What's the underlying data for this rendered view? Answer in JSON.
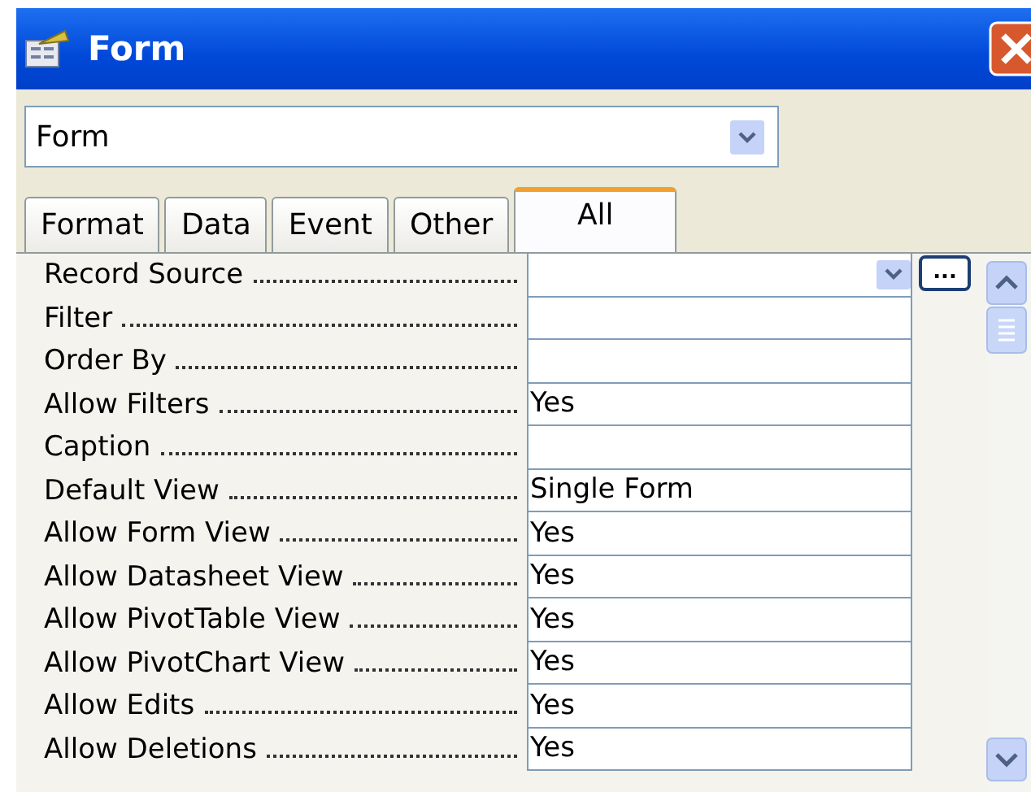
{
  "window": {
    "title": "Form"
  },
  "object_selector": {
    "value": "Form"
  },
  "tabs": [
    {
      "label": "Format",
      "selected": false
    },
    {
      "label": "Data",
      "selected": false
    },
    {
      "label": "Event",
      "selected": false
    },
    {
      "label": "Other",
      "selected": false
    },
    {
      "label": "All",
      "selected": true
    }
  ],
  "properties": [
    {
      "name": "Record Source",
      "kind": "combo",
      "builder": "..."
    },
    {
      "name": "Filter",
      "kind": "text"
    },
    {
      "name": "Order By",
      "kind": "text"
    },
    {
      "name": "Allow Filters",
      "value": "Yes",
      "kind": "text"
    },
    {
      "name": "Caption",
      "kind": "text"
    },
    {
      "name": "Default View",
      "value": "Single Form",
      "kind": "text"
    },
    {
      "name": "Allow Form View",
      "value": "Yes",
      "kind": "text"
    },
    {
      "name": "Allow Datasheet View",
      "value": "Yes",
      "kind": "text"
    },
    {
      "name": "Allow PivotTable View",
      "value": "Yes",
      "kind": "text"
    },
    {
      "name": "Allow PivotChart View",
      "value": "Yes",
      "kind": "text"
    },
    {
      "name": "Allow Edits",
      "value": "Yes",
      "kind": "text"
    },
    {
      "name": "Allow Deletions",
      "value": "Yes",
      "kind": "text"
    }
  ]
}
